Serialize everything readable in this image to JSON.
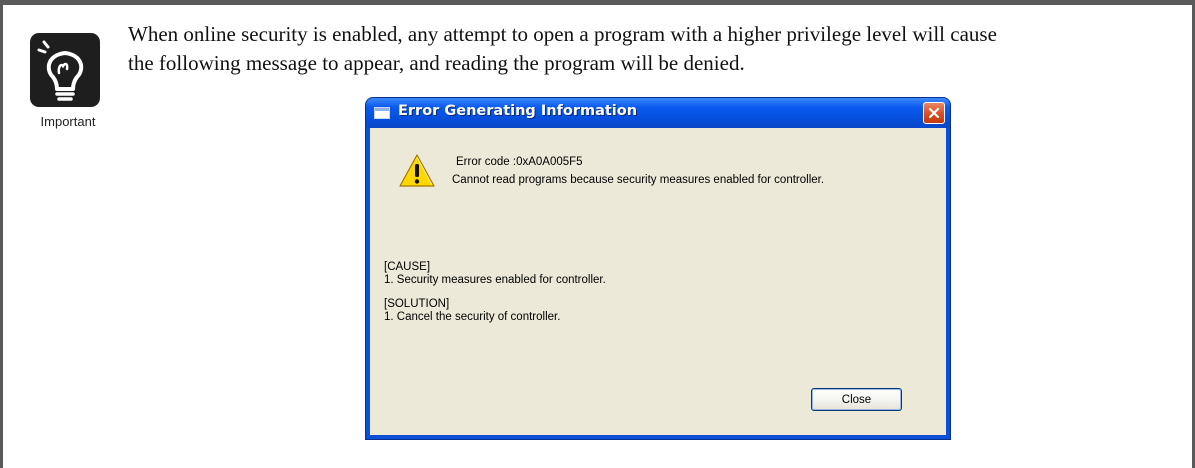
{
  "important": {
    "label": "Important",
    "icon": "lightbulb-icon"
  },
  "intro": {
    "line1": "When online security is enabled, any attempt to open a program with a higher privilege level will cause",
    "line2": "the following message to appear, and reading the program will be denied."
  },
  "dialog": {
    "title": "Error Generating Information",
    "title_icon": "window-icon",
    "close_icon": "close-icon",
    "warning_icon": "warning-icon",
    "error_code": "Error code :0xA0A005F5",
    "error_message": "Cannot read programs because security measures enabled for controller.",
    "cause_heading": "[CAUSE]",
    "cause_text": "1. Security measures enabled for controller.",
    "solution_heading": "[SOLUTION]",
    "solution_text": "1. Cancel the security of controller.",
    "close_button": "Close"
  },
  "colors": {
    "titlebar_blue": "#0551e0",
    "dialog_face": "#ece9d8",
    "close_red": "#d64a1e",
    "warning_yellow": "#ffd700"
  }
}
